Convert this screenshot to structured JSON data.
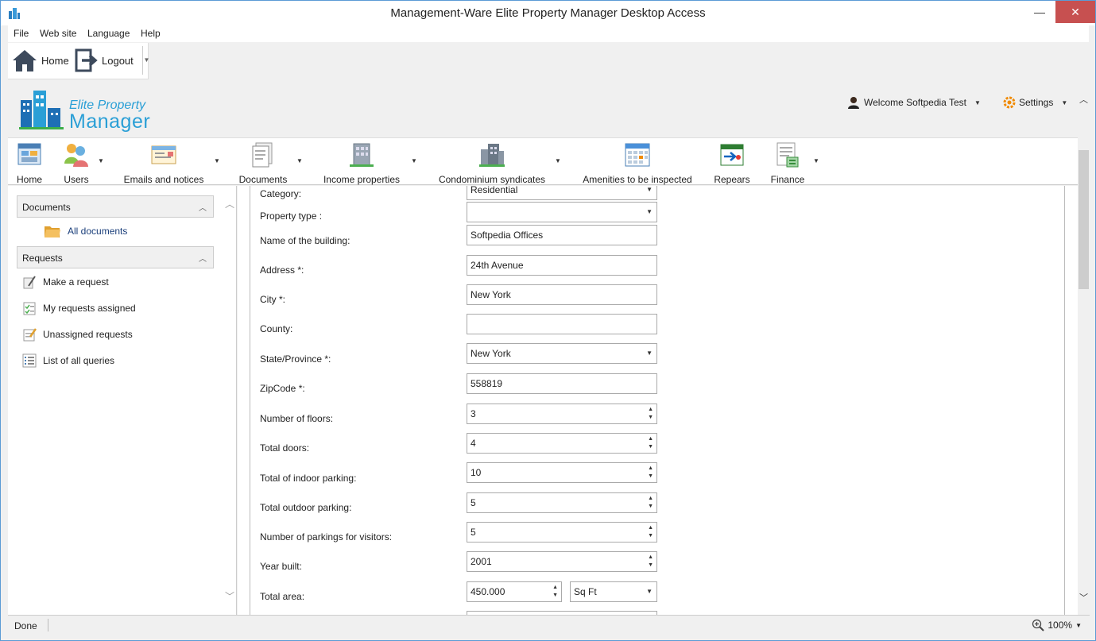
{
  "window": {
    "title": "Management-Ware Elite Property Manager Desktop Access",
    "min": "—",
    "close": "✕"
  },
  "menu": [
    "File",
    "Web site",
    "Language",
    "Help"
  ],
  "quick": {
    "home": "Home",
    "logout": "Logout"
  },
  "logo": {
    "line1": "Elite Property",
    "line2": "Manager"
  },
  "user": {
    "welcome": "Welcome Softpedia Test",
    "settings": "Settings"
  },
  "toolbar": [
    {
      "label": "Home",
      "icon": "home-icon"
    },
    {
      "label": "Users",
      "icon": "users-icon"
    },
    {
      "label": "Emails and notices",
      "icon": "email-icon"
    },
    {
      "label": "Documents",
      "icon": "documents-icon"
    },
    {
      "label": "Income properties",
      "icon": "building-icon"
    },
    {
      "label": "Condominium syndicates",
      "icon": "condo-icon"
    },
    {
      "label": "Amenities to be inspected",
      "icon": "calendar-icon"
    },
    {
      "label": "Repears",
      "icon": "repairs-icon"
    },
    {
      "label": "Finance",
      "icon": "finance-icon"
    }
  ],
  "sidebar": {
    "documents_header": "Documents",
    "all_documents": "All documents",
    "requests_header": "Requests",
    "requests": [
      "Make a request",
      "My requests assigned",
      "Unassigned requests",
      "List of all queries"
    ]
  },
  "form": {
    "category": {
      "label": "Category:",
      "value": "Residential"
    },
    "property_type": {
      "label": "Property type :",
      "value": ""
    },
    "building_name": {
      "label": "Name of the building:",
      "value": "Softpedia Offices"
    },
    "address": {
      "label": "Address *:",
      "value": "24th Avenue"
    },
    "city": {
      "label": "City *:",
      "value": "New York"
    },
    "county": {
      "label": "County:",
      "value": ""
    },
    "state": {
      "label": "State/Province *:",
      "value": "New York"
    },
    "zip": {
      "label": "ZipCode *:",
      "value": "558819"
    },
    "floors": {
      "label": "Number of floors:",
      "value": "3"
    },
    "doors": {
      "label": "Total doors:",
      "value": "4"
    },
    "indoor_parking": {
      "label": "Total of indoor parking:",
      "value": "10"
    },
    "outdoor_parking": {
      "label": "Total outdoor parking:",
      "value": "5"
    },
    "visitor_parking": {
      "label": "Number of parkings for visitors:",
      "value": "5"
    },
    "year_built": {
      "label": "Year built:",
      "value": "2001"
    },
    "total_area": {
      "label": "Total area:",
      "value": "450.000",
      "unit": "Sq Ft"
    }
  },
  "status": {
    "text": "Done",
    "zoom": "100%"
  }
}
